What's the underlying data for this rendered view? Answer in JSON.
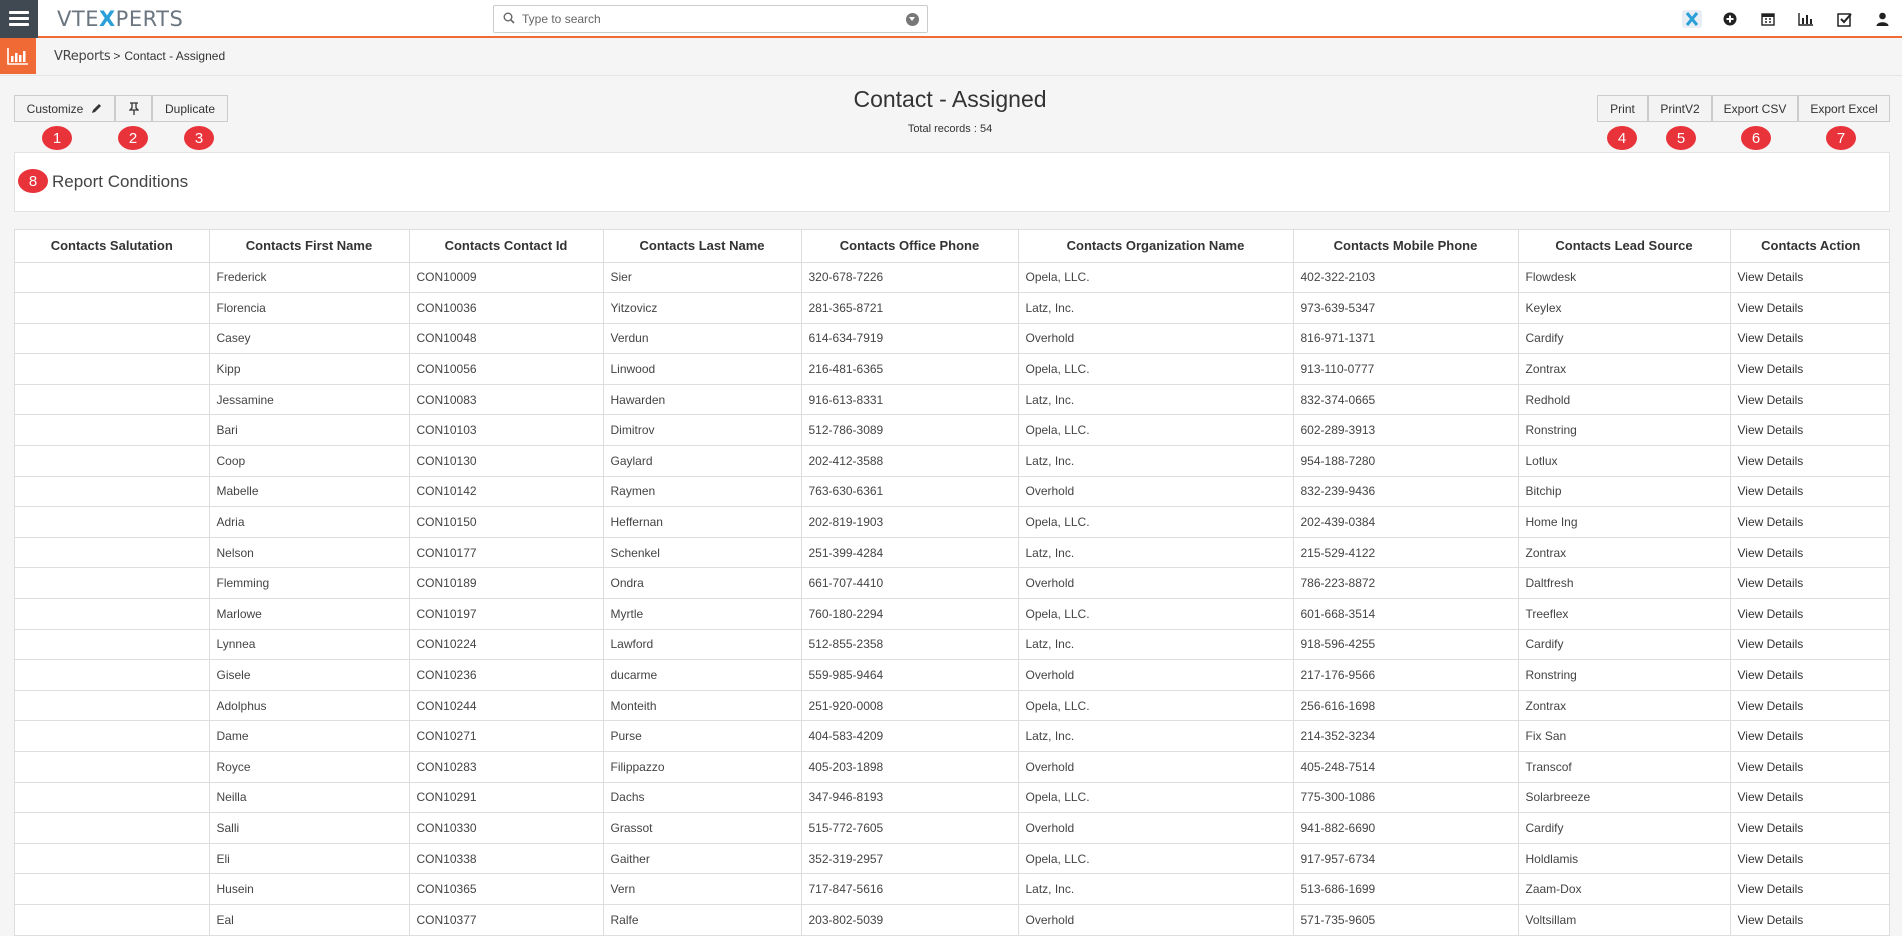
{
  "brand": {
    "logo_prefix": "VTE",
    "logo_x": "X",
    "logo_suffix": "PERTS"
  },
  "search": {
    "placeholder": "Type to search"
  },
  "top_icons": [
    "app-x-icon",
    "plus-circle-icon",
    "calendar-icon",
    "bar-chart-icon",
    "checkbox-icon",
    "user-icon"
  ],
  "breadcrumb": {
    "module": "VReports",
    "separator": ">",
    "current": "Contact - Assigned"
  },
  "report": {
    "title": "Contact - Assigned",
    "subtitle": "Total records : 54"
  },
  "toolbar": {
    "customize": "Customize",
    "pin_icon": "pin-icon",
    "duplicate": "Duplicate",
    "print": "Print",
    "printv2": "PrintV2",
    "export_csv": "Export CSV",
    "export_excel": "Export Excel"
  },
  "badges": [
    "1",
    "2",
    "3",
    "4",
    "5",
    "6",
    "7",
    "8"
  ],
  "conditions": {
    "label": "Report Conditions"
  },
  "colors": {
    "accent": "#f06a35",
    "badge": "#e8333a",
    "menu_bg": "#404952"
  },
  "table": {
    "columns": [
      "Contacts Salutation",
      "Contacts First Name",
      "Contacts Contact Id",
      "Contacts Last Name",
      "Contacts Office Phone",
      "Contacts Organization Name",
      "Contacts Mobile Phone",
      "Contacts Lead Source",
      "Contacts Action"
    ],
    "rows": [
      [
        "",
        "Frederick",
        "CON10009",
        "Sier",
        "320-678-7226",
        "Opela, LLC.",
        "402-322-2103",
        "Flowdesk",
        "View Details"
      ],
      [
        "",
        "Florencia",
        "CON10036",
        "Yitzovicz",
        "281-365-8721",
        "Latz, Inc.",
        "973-639-5347",
        "Keylex",
        "View Details"
      ],
      [
        "",
        "Casey",
        "CON10048",
        "Verdun",
        "614-634-7919",
        "Overhold",
        "816-971-1371",
        "Cardify",
        "View Details"
      ],
      [
        "",
        "Kipp",
        "CON10056",
        "Linwood",
        "216-481-6365",
        "Opela, LLC.",
        "913-110-0777",
        "Zontrax",
        "View Details"
      ],
      [
        "",
        "Jessamine",
        "CON10083",
        "Hawarden",
        "916-613-8331",
        "Latz, Inc.",
        "832-374-0665",
        "Redhold",
        "View Details"
      ],
      [
        "",
        "Bari",
        "CON10103",
        "Dimitrov",
        "512-786-3089",
        "Opela, LLC.",
        "602-289-3913",
        "Ronstring",
        "View Details"
      ],
      [
        "",
        "Coop",
        "CON10130",
        "Gaylard",
        "202-412-3588",
        "Latz, Inc.",
        "954-188-7280",
        "Lotlux",
        "View Details"
      ],
      [
        "",
        "Mabelle",
        "CON10142",
        "Raymen",
        "763-630-6361",
        "Overhold",
        "832-239-9436",
        "Bitchip",
        "View Details"
      ],
      [
        "",
        "Adria",
        "CON10150",
        "Heffernan",
        "202-819-1903",
        "Opela, LLC.",
        "202-439-0384",
        "Home Ing",
        "View Details"
      ],
      [
        "",
        "Nelson",
        "CON10177",
        "Schenkel",
        "251-399-4284",
        "Latz, Inc.",
        "215-529-4122",
        "Zontrax",
        "View Details"
      ],
      [
        "",
        "Flemming",
        "CON10189",
        "Ondra",
        "661-707-4410",
        "Overhold",
        "786-223-8872",
        "Daltfresh",
        "View Details"
      ],
      [
        "",
        "Marlowe",
        "CON10197",
        "Myrtle",
        "760-180-2294",
        "Opela, LLC.",
        "601-668-3514",
        "Treeflex",
        "View Details"
      ],
      [
        "",
        "Lynnea",
        "CON10224",
        "Lawford",
        "512-855-2358",
        "Latz, Inc.",
        "918-596-4255",
        "Cardify",
        "View Details"
      ],
      [
        "",
        "Gisele",
        "CON10236",
        "ducarme",
        "559-985-9464",
        "Overhold",
        "217-176-9566",
        "Ronstring",
        "View Details"
      ],
      [
        "",
        "Adolphus",
        "CON10244",
        "Monteith",
        "251-920-0008",
        "Opela, LLC.",
        "256-616-1698",
        "Zontrax",
        "View Details"
      ],
      [
        "",
        "Dame",
        "CON10271",
        "Purse",
        "404-583-4209",
        "Latz, Inc.",
        "214-352-3234",
        "Fix San",
        "View Details"
      ],
      [
        "",
        "Royce",
        "CON10283",
        "Filippazzo",
        "405-203-1898",
        "Overhold",
        "405-248-7514",
        "Transcof",
        "View Details"
      ],
      [
        "",
        "Neilla",
        "CON10291",
        "Dachs",
        "347-946-8193",
        "Opela, LLC.",
        "775-300-1086",
        "Solarbreeze",
        "View Details"
      ],
      [
        "",
        "Salli",
        "CON10330",
        "Grassot",
        "515-772-7605",
        "Overhold",
        "941-882-6690",
        "Cardify",
        "View Details"
      ],
      [
        "",
        "Eli",
        "CON10338",
        "Gaither",
        "352-319-2957",
        "Opela, LLC.",
        "917-957-6734",
        "Holdlamis",
        "View Details"
      ],
      [
        "",
        "Husein",
        "CON10365",
        "Vern",
        "717-847-5616",
        "Latz, Inc.",
        "513-686-1699",
        "Zaam-Dox",
        "View Details"
      ],
      [
        "",
        "Eal",
        "CON10377",
        "Ralfe",
        "203-802-5039",
        "Overhold",
        "571-735-9605",
        "Voltsillam",
        "View Details"
      ]
    ]
  }
}
